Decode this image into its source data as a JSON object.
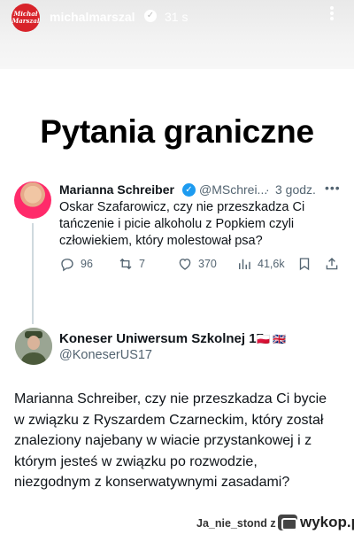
{
  "story": {
    "username": "michalmarszal",
    "time": "31 s",
    "avatar_text_line1": "Michał",
    "avatar_text_line2": "Marszal"
  },
  "title": "Pytania graniczne",
  "tweet1": {
    "name": "Marianna Schreiber",
    "handle": "@MSchrei...",
    "time": "3 godz.",
    "text_lines": [
      "Oskar Szafarowicz, czy nie przeszkadza Ci",
      "tańczenie i picie alkoholu z Popkiem czyli",
      "człowiekiem, który molestował psa?"
    ],
    "replies": "96",
    "retweets": "7",
    "likes": "370",
    "views": "41,6k"
  },
  "tweet2": {
    "name": "Koneser Uniwersum Szkolnej 17",
    "flags": "🇵🇱 🇬🇧",
    "handle": "@KoneserUS17",
    "text_lines": [
      "Marianna Schreiber, czy nie przeszkadza Ci bycie",
      "w związku z Ryszardem Czarneckim, który został",
      "znaleziony najebany w wiacie przystankowej i z",
      "którym jesteś w związku po rozwodzie,",
      "niezgodnym z konserwatywnymi zasadami?"
    ]
  },
  "footer": {
    "user": "Ja_nie_stond z",
    "brand": "wykop.pl"
  },
  "colors": {
    "verified": "#1d9bf0",
    "secondary_text": "#536471",
    "story_avatar": "#d8232a"
  }
}
